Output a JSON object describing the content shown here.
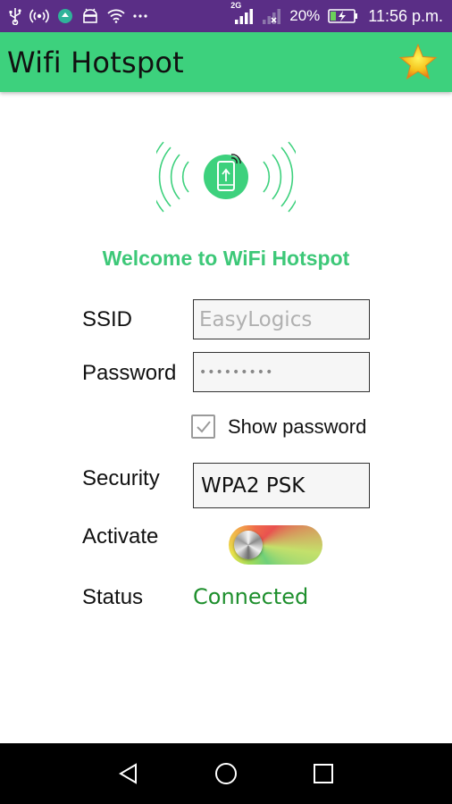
{
  "status_bar": {
    "network_label": "2G",
    "battery": "20%",
    "time": "11:56 p.m.",
    "icons": [
      "usb-icon",
      "hotspot-icon",
      "app-icon",
      "android-debug-icon",
      "wifi-icon",
      "more-icon",
      "signal-icon",
      "no-signal-icon",
      "battery-charging-icon"
    ],
    "background": "#5a2e86"
  },
  "app_bar": {
    "title": "Wifi Hotspot",
    "background": "#3dd17d",
    "action_icon": "star-icon"
  },
  "hero": {
    "icon": "hotspot-phone-icon",
    "accent": "#3dd17d"
  },
  "welcome": "Welcome to WiFi Hotspot",
  "form": {
    "ssid_label": "SSID",
    "ssid_placeholder": "EasyLogics",
    "password_label": "Password",
    "password_mask": "•••••••••",
    "show_password_label": "Show password",
    "show_password_checked": true,
    "security_label": "Security",
    "security_value": "WPA2 PSK",
    "activate_label": "Activate",
    "activate_on": false,
    "status_label": "Status",
    "status_value": "Connected",
    "status_color": "#1e8f2d"
  },
  "nav_bar": {
    "buttons": [
      "back-icon",
      "home-icon",
      "recents-icon"
    ]
  }
}
